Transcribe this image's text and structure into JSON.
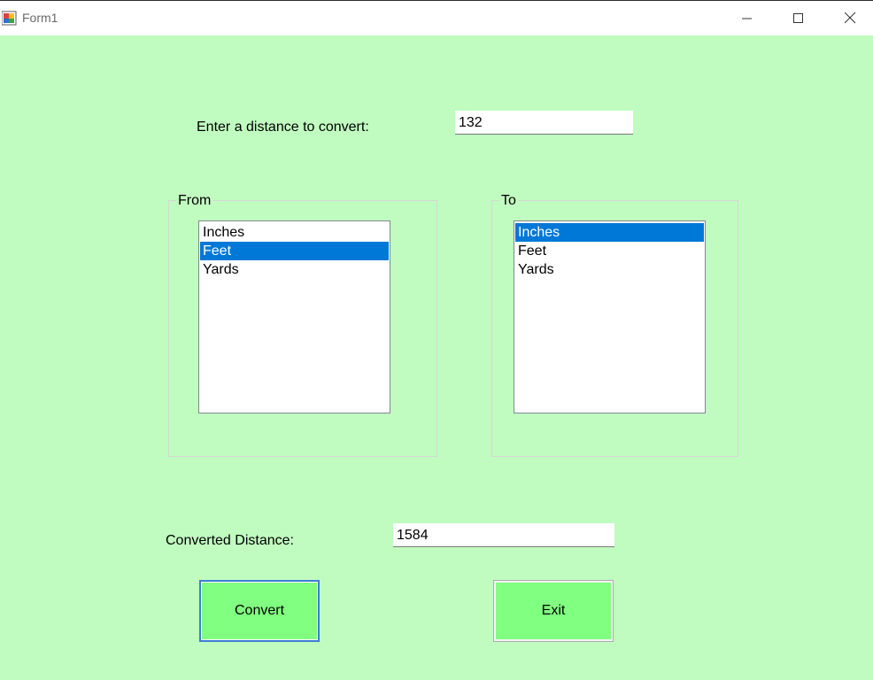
{
  "window": {
    "title": "Form1",
    "controls": [
      "minimize-icon",
      "maximize-icon",
      "close-icon"
    ]
  },
  "form": {
    "distance_label": "Enter a distance to convert:",
    "distance_value": "132",
    "from_group": {
      "caption": "From",
      "items": [
        "Inches",
        "Feet",
        "Yards"
      ],
      "selected": "Feet"
    },
    "to_group": {
      "caption": "To",
      "items": [
        "Inches",
        "Feet",
        "Yards"
      ],
      "selected": "Inches"
    },
    "converted_label": "Converted Distance:",
    "converted_value": "1584",
    "convert_button": "Convert",
    "exit_button": "Exit"
  },
  "colors": {
    "form_background": "#c0fcc0",
    "button_background": "#80ff80",
    "selection": "#0078d7"
  }
}
